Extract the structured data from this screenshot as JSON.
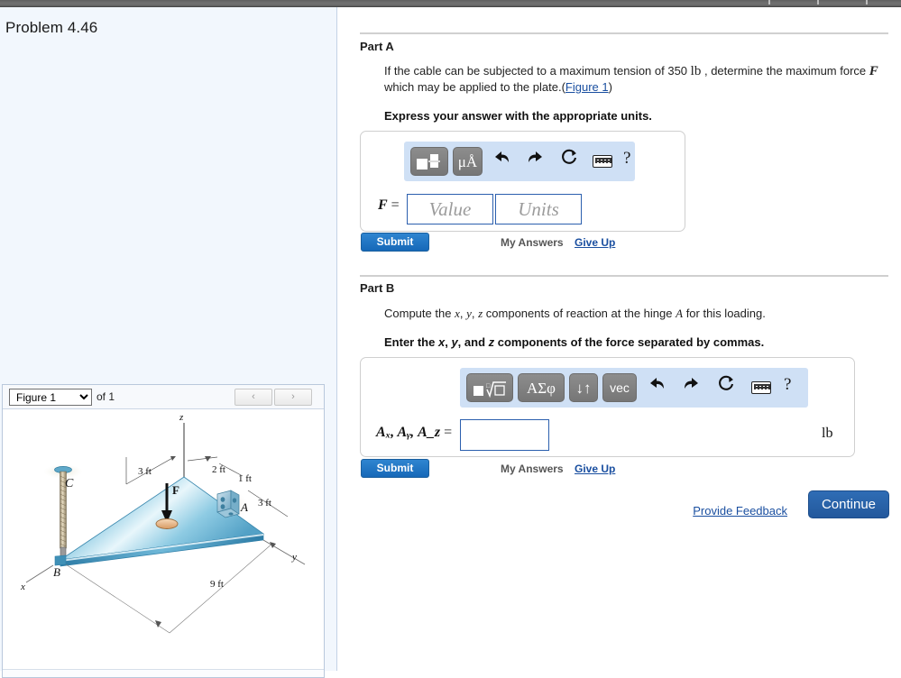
{
  "problem": {
    "title": "Problem 4.46"
  },
  "figure_viewer": {
    "selected": "Figure 1",
    "options": [
      "Figure 1"
    ],
    "of_label": "of 1",
    "prev_icon": "‹",
    "next_icon": "›"
  },
  "figure": {
    "labels": {
      "axis_x": "x",
      "axis_y": "y",
      "axis_z": "z",
      "point_a": "A",
      "point_b": "B",
      "point_c": "C",
      "force": "F",
      "dim_3ft_left": "3 ft",
      "dim_2ft": "2 ft",
      "dim_1ft": "1 ft",
      "dim_3ft_right": "3 ft",
      "dim_9ft": "9 ft"
    },
    "colors": {
      "plate_light": "#cfe8f4",
      "plate_mid": "#7fc0dd",
      "plate_dark": "#4f9cc2",
      "plate_edge": "#2e7fa8",
      "pad": "#e8b98a",
      "cable": "#b8a98a"
    }
  },
  "partA": {
    "heading": "Part A",
    "question_pre": "If the cable can be subjected to a maximum tension of 350",
    "question_unit": "lb",
    "question_mid": ", determine the maximum force",
    "question_symbol": "F",
    "question_line2": "which may be applied to the plate.(",
    "figure_link": "Figure 1",
    "question_close": ")",
    "directive": "Express your answer with the appropriate units.",
    "toolbar": [
      {
        "name": "template-button",
        "label": "■□"
      },
      {
        "name": "units-button",
        "label": "μÅ"
      },
      {
        "name": "undo-icon",
        "label": "↶"
      },
      {
        "name": "redo-icon",
        "label": "↷"
      },
      {
        "name": "reset-icon",
        "label": "↻"
      },
      {
        "name": "keyboard-icon",
        "label": ""
      },
      {
        "name": "help-icon",
        "label": "?"
      }
    ],
    "equation_label": "F",
    "equals": "=",
    "value_placeholder": "Value",
    "units_placeholder": "Units",
    "value_text": "",
    "units_text": "",
    "submit_label": "Submit",
    "my_answers_label": "My Answers",
    "give_up_label": "Give Up"
  },
  "partB": {
    "heading": "Part B",
    "question_pre": "Compute the",
    "var_x": "x",
    "var_y": "y",
    "var_z": "z",
    "question_mid": "components of reaction at the hinge",
    "hinge": "A",
    "question_end": "for this loading.",
    "directive_pre": "Enter the",
    "directive_end": "components of the force separated by commas.",
    "toolbar": [
      {
        "name": "template-root-button",
        "label": "■√"
      },
      {
        "name": "greek-letters-button",
        "label": "ΑΣφ"
      },
      {
        "name": "arrows-button",
        "label": "↓↑"
      },
      {
        "name": "vector-button",
        "label": "vec"
      },
      {
        "name": "undo-icon",
        "label": "↶"
      },
      {
        "name": "redo-icon",
        "label": "↷"
      },
      {
        "name": "reset-icon",
        "label": "↻"
      },
      {
        "name": "keyboard-icon",
        "label": ""
      },
      {
        "name": "help-icon",
        "label": "?"
      }
    ],
    "equation_label": "Aₓ, Aᵧ, A_z",
    "equals": "=",
    "answer_text": "",
    "unit": "lb",
    "submit_label": "Submit",
    "my_answers_label": "My Answers",
    "give_up_label": "Give Up"
  },
  "footer": {
    "provide_feedback": "Provide Feedback",
    "continue_label": "Continue"
  },
  "colors": {
    "accent_blue": "#1668b8",
    "link_blue": "#1a4fa0",
    "toolbar_bg": "#cfe0f5",
    "panel_bg": "#f2f7fd"
  }
}
